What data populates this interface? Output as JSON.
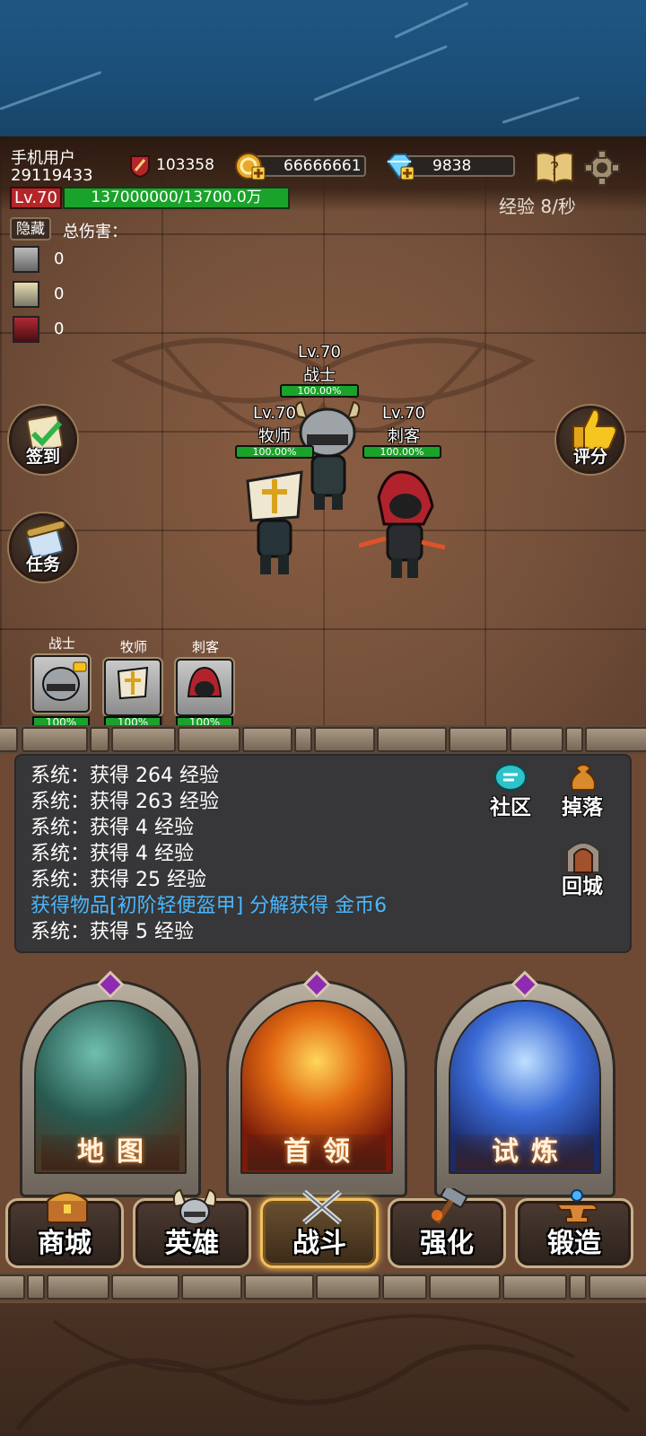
{
  "player": {
    "name": "手机用户",
    "id": "29119433",
    "level": "Lv.70",
    "exp_text": "137000000/13700.0万",
    "exp_rate": "经验 8/秒"
  },
  "resources": {
    "power": "103358",
    "gold": "66666661",
    "diamonds": "9838"
  },
  "damage_panel": {
    "hide_button": "隐藏",
    "total_label": "总伤害：",
    "rows": [
      {
        "hero": "warrior",
        "value": "0"
      },
      {
        "hero": "priest",
        "value": "0"
      },
      {
        "hero": "assassin",
        "value": "0"
      }
    ]
  },
  "side_buttons": {
    "checkin": "签到",
    "tasks": "任务",
    "rate": "评分"
  },
  "battle_heroes": [
    {
      "level": "Lv.70",
      "name": "战士",
      "hp": "100.00%"
    },
    {
      "level": "Lv.70",
      "name": "牧师",
      "hp": "100.00%"
    },
    {
      "level": "Lv.70",
      "name": "刺客",
      "hp": "100.00%"
    }
  ],
  "team": [
    {
      "name": "战士",
      "hp": "100%"
    },
    {
      "name": "牧师",
      "hp": "100%"
    },
    {
      "name": "刺客",
      "hp": "100%"
    }
  ],
  "chat": {
    "lines": [
      "系统：获得 264 经验",
      "系统：获得 263 经验",
      "系统：获得 4 经验",
      "系统：获得 4 经验",
      "系统：获得 25 经验",
      "获得物品[初阶轻便盔甲] 分解获得 金币6",
      "系统：获得 5 经验"
    ],
    "community": "社区",
    "drops": "掉落",
    "return_town": "回城"
  },
  "portals": {
    "map": "地图",
    "boss": "首领",
    "trial": "试炼"
  },
  "nav": {
    "shop": "商城",
    "heroes": "英雄",
    "battle": "战斗",
    "enhance": "强化",
    "forge": "锻造"
  },
  "colors": {
    "hp_green": "#1aa32a",
    "level_red": "#b3262a",
    "loot_blue": "#49b8ff",
    "portal_gem": "#8e2bb0"
  }
}
